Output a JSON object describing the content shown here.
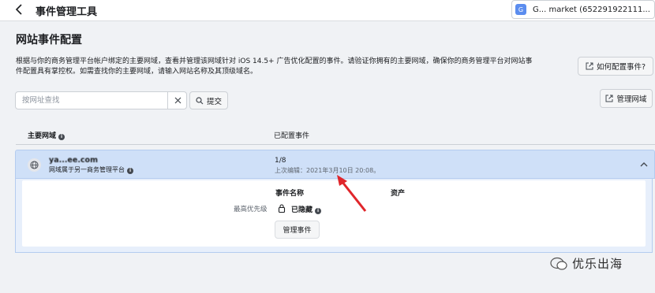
{
  "topbar": {
    "title": "事件管理工具",
    "account": {
      "initial": "G",
      "name": "G... market (652291922111..."
    }
  },
  "page": {
    "heading": "网站事件配置",
    "description": "根据与你的商务管理平台帐户绑定的主要网域，查看并管理该网域针对 iOS 14.5+ 广告优化配置的事件。请验证你拥有的主要网域，确保你的商务管理平台对网站事件配置具有掌控权。如需查找你的主要网域，请输入网站名称及其顶级域名。",
    "how_to_button": "如何配置事件?",
    "manage_domains_button": "管理网域"
  },
  "search": {
    "placeholder": "按网址查找",
    "value": "",
    "submit_label": "提交"
  },
  "table": {
    "col_domain": "主要网域",
    "col_configured": "已配置事件"
  },
  "row": {
    "domain": "ya...ee.com",
    "owner_note": "网域属于另一商务管理平台",
    "configured": "1/8",
    "last_edit": "上次编辑：2021年3月10日 20:08。",
    "detail": {
      "col_event_name": "事件名称",
      "col_asset": "资产",
      "priority_label": "最高优先级",
      "status": "已隐藏",
      "manage_button": "管理事件"
    }
  },
  "watermark": {
    "text": "优乐出海"
  },
  "colors": {
    "selected_row": "#cfe0f8",
    "annotation_arrow": "#e0262b"
  },
  "icons": [
    "chevron-left-icon",
    "external-link-icon",
    "search-icon",
    "close-icon",
    "globe-icon",
    "info-icon",
    "chevron-up-icon",
    "lock-icon"
  ]
}
